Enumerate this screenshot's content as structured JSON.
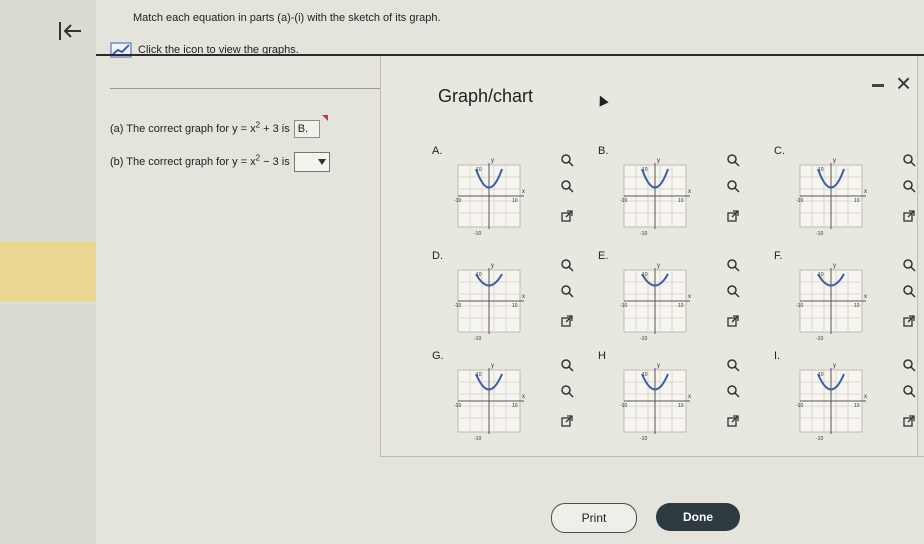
{
  "header": {
    "instruction": "Match each equation in parts (a)-(i) with the sketch of its graph.",
    "graph_link_label": "Click the icon to view the graphs."
  },
  "popup": {
    "title": "Graph/chart"
  },
  "questions": [
    {
      "label": "(a) The correct graph for y = x",
      "exponent": "2",
      "suffix": " + 3 is",
      "answer": "B."
    },
    {
      "label": "(b) The correct graph for y = x",
      "exponent": "2",
      "suffix": " − 3 is",
      "answer": ""
    }
  ],
  "options": [
    "A.",
    "B.",
    "C.",
    "D.",
    "E.",
    "F.",
    "G.",
    "H",
    "I."
  ],
  "graph_labels": {
    "y": "y",
    "x": "x",
    "pos": "10",
    "neg": "-10",
    "left": "-10",
    "right": "10"
  },
  "buttons": {
    "print": "Print",
    "done": "Done"
  },
  "colors": {
    "accent": "#3c5fa8",
    "danger": "#c93b35",
    "dark_button": "#2d3a3f"
  }
}
